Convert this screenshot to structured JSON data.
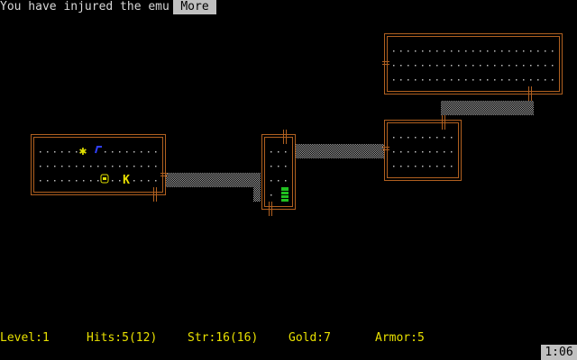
{
  "message": {
    "text": "You have injured the emu",
    "more_label": "More"
  },
  "status": {
    "level": "Level:1",
    "hits": "Hits:5(12)",
    "str": "Str:16(16)",
    "gold": "Gold:7",
    "armor": "Armor:5"
  },
  "clock": "1:06",
  "map": {
    "monster_letter": "K",
    "colors": {
      "wall": "#b06020",
      "floor": "#bcbcbc",
      "passage": "#9a9a9a",
      "player": "#e0e000",
      "gold": "#e0e000",
      "item": "#3040ff",
      "stairs": "#20c020",
      "text": "#e8e000"
    }
  }
}
